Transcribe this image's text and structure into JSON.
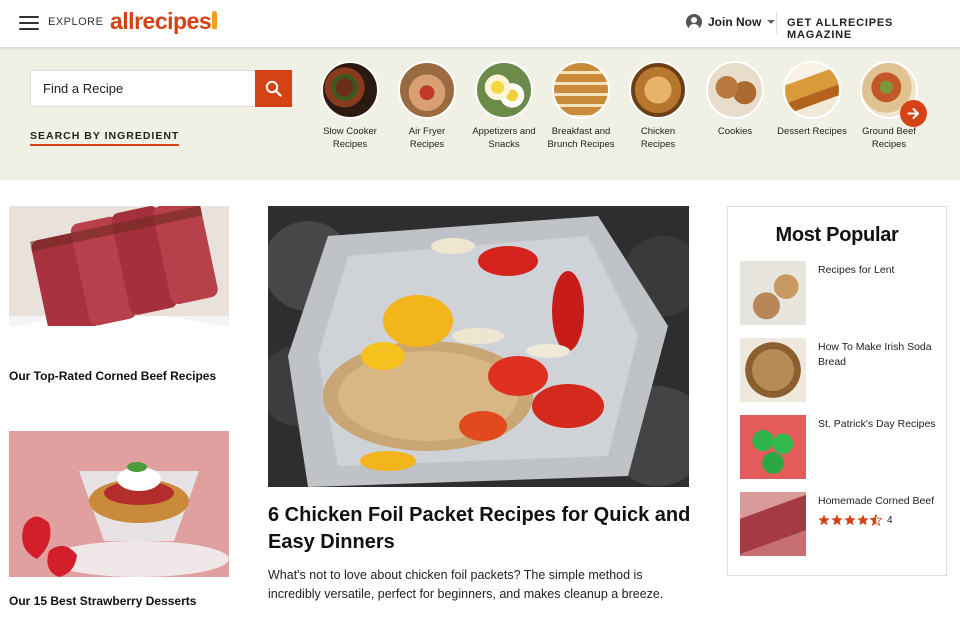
{
  "header": {
    "explore_label": "EXPLORE",
    "logo_text": "allrecipes",
    "join_label": "Join Now",
    "magazine_label": "GET ALLRECIPES MAGAZINE"
  },
  "search": {
    "placeholder": "Find a Recipe",
    "by_ingredient_label": "SEARCH BY INGREDIENT"
  },
  "categories": [
    {
      "line1": "Slow Cooker",
      "line2": "Recipes"
    },
    {
      "line1": "Air Fryer",
      "line2": "Recipes"
    },
    {
      "line1": "Appetizers and",
      "line2": "Snacks"
    },
    {
      "line1": "Breakfast and",
      "line2": "Brunch Recipes"
    },
    {
      "line1": "Chicken",
      "line2": "Recipes"
    },
    {
      "line1": "Cookies",
      "line2": ""
    },
    {
      "line1": "Dessert Recipes",
      "line2": ""
    },
    {
      "line1": "Ground Beef",
      "line2": "Recipes"
    }
  ],
  "cards": {
    "corned_beef_title": "Our Top-Rated Corned Beef Recipes",
    "strawberry_title": "Our 15 Best Strawberry Desserts"
  },
  "hero": {
    "title": "6 Chicken Foil Packet Recipes for Quick and Easy Dinners",
    "description": "What's not to love about chicken foil packets? The simple method is incredibly versatile, perfect for beginners, and makes cleanup a breeze."
  },
  "popular": {
    "heading": "Most Popular",
    "items": [
      {
        "label": "Recipes for Lent"
      },
      {
        "label": "How To Make Irish Soda Bread"
      },
      {
        "label": "St. Patrick's Day Recipes"
      },
      {
        "label": "Homemade Corned Beef",
        "rating_stars": 4.5,
        "rating_count": "4"
      }
    ]
  },
  "colors": {
    "brand": "#d54215",
    "logo_accent": "#f0a020",
    "band_bg": "#f1f0e5",
    "star": "#d54215"
  },
  "icons": {
    "menu": "hamburger-menu-icon",
    "search": "search-icon",
    "user": "user-icon",
    "next": "arrow-right-icon",
    "star": "star-icon"
  }
}
